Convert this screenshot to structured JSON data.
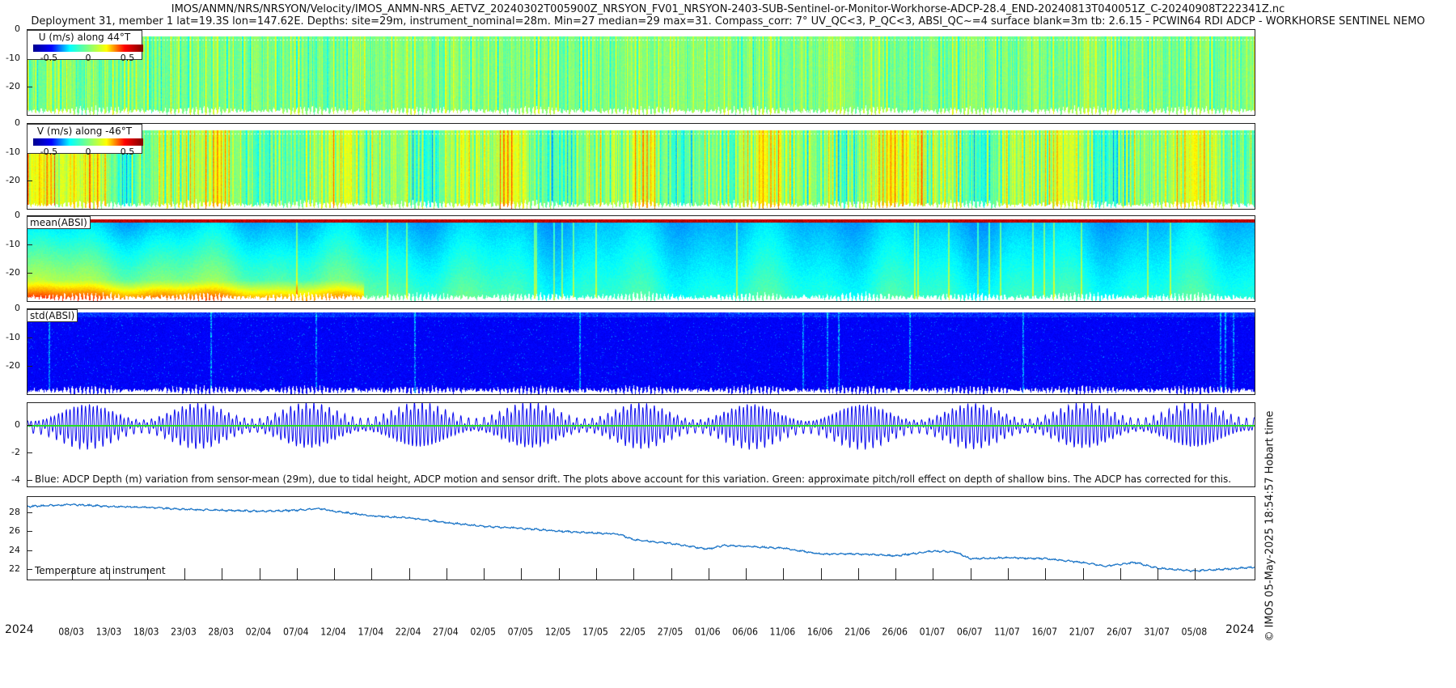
{
  "title_line1": "IMOS/ANMN/NRS/NRSYON/Velocity/IMOS_ANMN-NRS_AETVZ_20240302T005900Z_NRSYON_FV01_NRSYON-2403-SUB-Sentinel-or-Monitor-Workhorse-ADCP-28.4_END-20240813T040051Z_C-20240908T222341Z.nc",
  "title_line2": "Deployment 31, member 1 lat=19.3S lon=147.62E. Depths: site=29m, instrument_nominal=28m. Min=27 median=29 max=31. Compass_corr: 7° UV_QC<3, P_QC<3, ABSI_QC~=4 surface blank=3m tb: 2.6.15 - PCWIN64 RDI ADCP - WORKHORSE SENTINEL NEMO",
  "timestamp_text": "© IMOS 05-May-2025 18:54:57 Hobart time",
  "chart_data": [
    {
      "type": "heatmap",
      "name": "u",
      "legend_title": "U (m/s) along 44°T",
      "colormap": "jet",
      "clim": [
        -0.7,
        0.7
      ],
      "colorbar_ticks": [
        "-0.5",
        "0",
        "0.5"
      ],
      "yticks": [
        "0",
        "-10",
        "-20"
      ],
      "ylim": [
        -30,
        0
      ]
    },
    {
      "type": "heatmap",
      "name": "v",
      "legend_title": "V (m/s) along -46°T",
      "colormap": "jet",
      "clim": [
        -0.7,
        0.7
      ],
      "colorbar_ticks": [
        "-0.5",
        "0",
        "0.5"
      ],
      "yticks": [
        "0",
        "-10",
        "-20"
      ],
      "ylim": [
        -30,
        0
      ]
    },
    {
      "type": "heatmap",
      "name": "mean_absi",
      "legend_title": "mean(ABSI)",
      "colormap": "jet",
      "yticks": [
        "0",
        "-10",
        "-20"
      ],
      "ylim": [
        -30,
        0
      ]
    },
    {
      "type": "heatmap",
      "name": "std_absi",
      "legend_title": "std(ABSI)",
      "colormap": "jet",
      "yticks": [
        "0",
        "-10",
        "-20"
      ],
      "ylim": [
        -30,
        0
      ]
    },
    {
      "type": "line",
      "name": "depth_variation",
      "yticks": [
        "0",
        "-2",
        "-4"
      ],
      "series_colors": {
        "depth": "#1010ee",
        "pitch_roll": "#22dd22"
      },
      "annotation": "Blue: ADCP Depth (m) variation from sensor-mean (29m), due to tidal height, ADCP motion and sensor drift. The plots above account for this variation. Green: approximate pitch/roll effect on depth of shallow bins. The ADCP has corrected for this."
    },
    {
      "type": "line",
      "name": "temperature",
      "annotation": "Temperature at instrument",
      "color": "#1f77c8",
      "yticks": [
        "22",
        "24",
        "26",
        "28"
      ],
      "ylim": [
        21,
        29.7
      ],
      "x": [
        "2024-03-02",
        "2024-03-08",
        "2024-03-13",
        "2024-03-18",
        "2024-03-23",
        "2024-03-28",
        "2024-04-02",
        "2024-04-07",
        "2024-04-10",
        "2024-04-12",
        "2024-04-17",
        "2024-04-22",
        "2024-04-27",
        "2024-05-02",
        "2024-05-07",
        "2024-05-12",
        "2024-05-17",
        "2024-05-20",
        "2024-05-22",
        "2024-05-27",
        "2024-06-01",
        "2024-06-03",
        "2024-06-06",
        "2024-06-11",
        "2024-06-16",
        "2024-06-21",
        "2024-06-26",
        "2024-07-01",
        "2024-07-04",
        "2024-07-06",
        "2024-07-11",
        "2024-07-16",
        "2024-07-21",
        "2024-07-24",
        "2024-07-28",
        "2024-07-31",
        "2024-08-05",
        "2024-08-13"
      ],
      "y": [
        28.7,
        28.9,
        28.7,
        28.6,
        28.4,
        28.3,
        28.2,
        28.3,
        28.5,
        28.2,
        27.7,
        27.5,
        27.0,
        26.6,
        26.4,
        26.1,
        25.9,
        25.8,
        25.2,
        24.8,
        24.2,
        24.6,
        24.5,
        24.3,
        23.7,
        23.7,
        23.5,
        24.0,
        23.9,
        23.2,
        23.3,
        23.2,
        22.8,
        22.4,
        22.8,
        22.2,
        21.9,
        22.3
      ]
    }
  ],
  "x_axis": {
    "year_left": "2024",
    "year_right": "2024",
    "ticks": [
      "08/03",
      "13/03",
      "18/03",
      "23/03",
      "28/03",
      "02/04",
      "07/04",
      "12/04",
      "17/04",
      "22/04",
      "27/04",
      "02/05",
      "07/05",
      "12/05",
      "17/05",
      "22/05",
      "27/05",
      "01/06",
      "06/06",
      "11/06",
      "16/06",
      "21/06",
      "26/06",
      "01/07",
      "06/07",
      "11/07",
      "16/07",
      "21/07",
      "26/07",
      "31/07",
      "05/08"
    ]
  }
}
